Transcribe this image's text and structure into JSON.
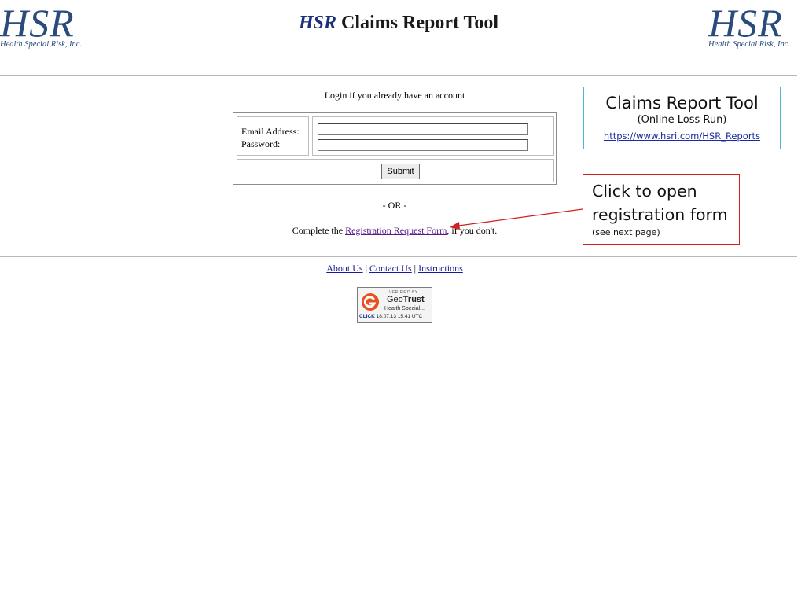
{
  "header": {
    "logo_text": "HSR",
    "logo_subtitle": "Health Special Risk, Inc.",
    "title_brand": "HSR",
    "title_rest": " Claims Report Tool"
  },
  "login": {
    "heading": "Login if you already have an account",
    "email_label": "Email Address:",
    "password_label": "Password:",
    "email_value": "",
    "password_value": "",
    "submit_label": "Submit"
  },
  "or_text": "- OR -",
  "registration": {
    "prefix": "Complete the ",
    "link_text": "Registration Request Form",
    "suffix": ", if you don't."
  },
  "footer": {
    "links": [
      "About Us",
      "Contact Us",
      "Instructions"
    ],
    "separator": "|"
  },
  "badge": {
    "verified_text": "VERIFIED BY",
    "brand_geo": "Geo",
    "brand_trust": "Trust",
    "company": "Health Special...",
    "click_text": "CLICK",
    "timestamp": "18.07.13 15:41 UTC"
  },
  "info_box": {
    "title": "Claims Report Tool",
    "subtitle": "(Online Loss Run)",
    "url": "https://www.hsri.com/HSR_Reports"
  },
  "callout": {
    "line1": "Click to open",
    "line2": "registration form",
    "note": "(see next page)",
    "color": "#d02020"
  },
  "colors": {
    "logo": "#2a4c7c",
    "title_brand": "#1c2f7a",
    "link_visited": "#5a1a8c",
    "link": "#1a1a9c",
    "info_border": "#4fb4d8"
  }
}
